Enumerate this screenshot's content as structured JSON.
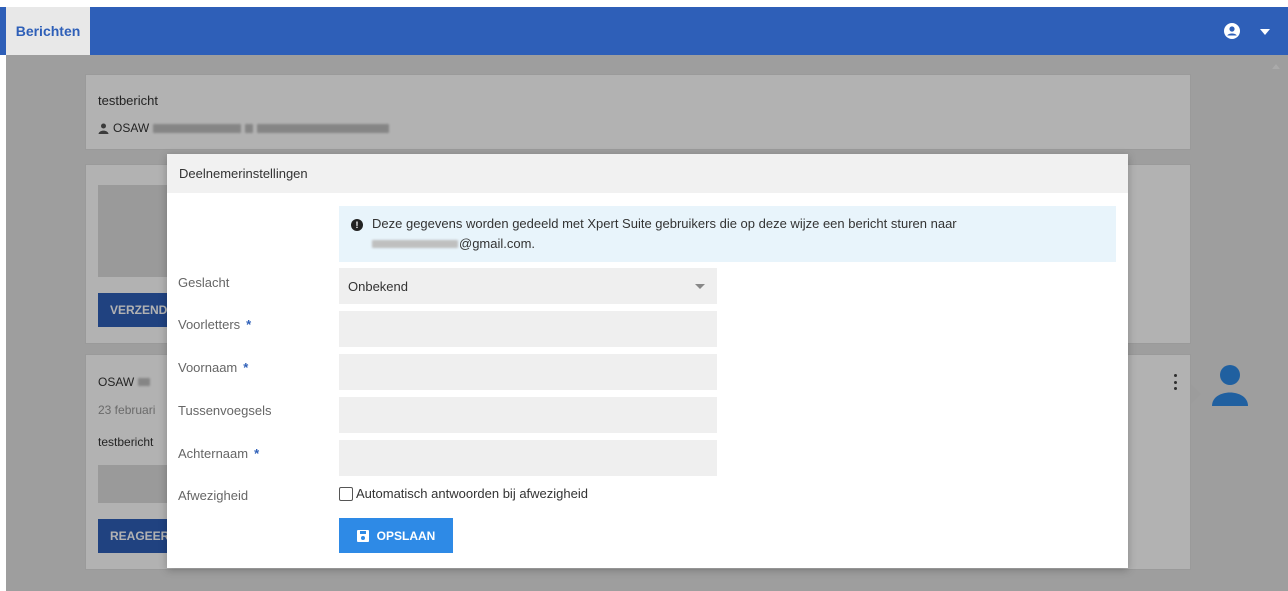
{
  "topbar": {
    "tab_label": "Berichten",
    "accent": "#2e5fb8"
  },
  "card1": {
    "title": "testbericht",
    "author_prefix": "OSAW"
  },
  "card2": {
    "button_label": "VERZEND"
  },
  "card3": {
    "name": "OSAW",
    "date": "23 februari",
    "text": "testbericht",
    "button_label": "REAGEER"
  },
  "modal": {
    "title": "Deelnemerinstellingen",
    "info_text": "Deze gegevens worden gedeeld met Xpert Suite gebruikers die op deze wijze een bericht sturen naar",
    "info_email_suffix": "@gmail.com.",
    "fields": {
      "geslacht": {
        "label": "Geslacht",
        "value": "Onbekend"
      },
      "voorletters": {
        "label": "Voorletters",
        "value": ""
      },
      "voornaam": {
        "label": "Voornaam",
        "value": ""
      },
      "tussenvoegsels": {
        "label": "Tussenvoegsels",
        "value": ""
      },
      "achternaam": {
        "label": "Achternaam",
        "value": ""
      },
      "afwezigheid": {
        "label": "Afwezigheid",
        "checkbox_label": "Automatisch antwoorden bij afwezigheid",
        "checked": false
      }
    },
    "required_marker": "*",
    "save_label": "OPSLAAN"
  }
}
